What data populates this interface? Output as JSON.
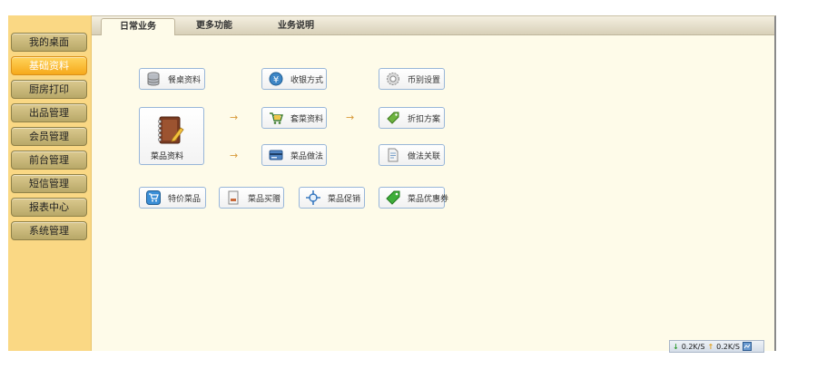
{
  "sidebar": {
    "items": [
      {
        "label": "我的桌面"
      },
      {
        "label": "基础资料"
      },
      {
        "label": "厨房打印"
      },
      {
        "label": "出品管理"
      },
      {
        "label": "会员管理"
      },
      {
        "label": "前台管理"
      },
      {
        "label": "短信管理"
      },
      {
        "label": "报表中心"
      },
      {
        "label": "系统管理"
      }
    ],
    "active_index": 1
  },
  "tabs": [
    {
      "label": "日常业务"
    },
    {
      "label": "更多功能"
    },
    {
      "label": "业务说明"
    }
  ],
  "features": {
    "table_data": "餐桌资料",
    "payment_method": "收银方式",
    "currency_settings": "币别设置",
    "dish_data": "菜品资料",
    "set_meal_data": "套菜资料",
    "discount_scheme": "折扣方案",
    "dish_method": "菜品做法",
    "method_link": "做法关联",
    "special_dish": "特价菜品",
    "dish_buy_gift": "菜品买赠",
    "dish_promotion": "菜品促销",
    "dish_coupon": "菜品优惠券"
  },
  "arrow_glyph": "→",
  "status": {
    "download_speed": "0.2K/S",
    "upload_speed": "0.2K/S"
  },
  "colors": {
    "sidebar_bg": "#fad884",
    "active_button": "#f6a91b",
    "content_bg": "#fefbe9",
    "button_border": "#98b6d8"
  }
}
